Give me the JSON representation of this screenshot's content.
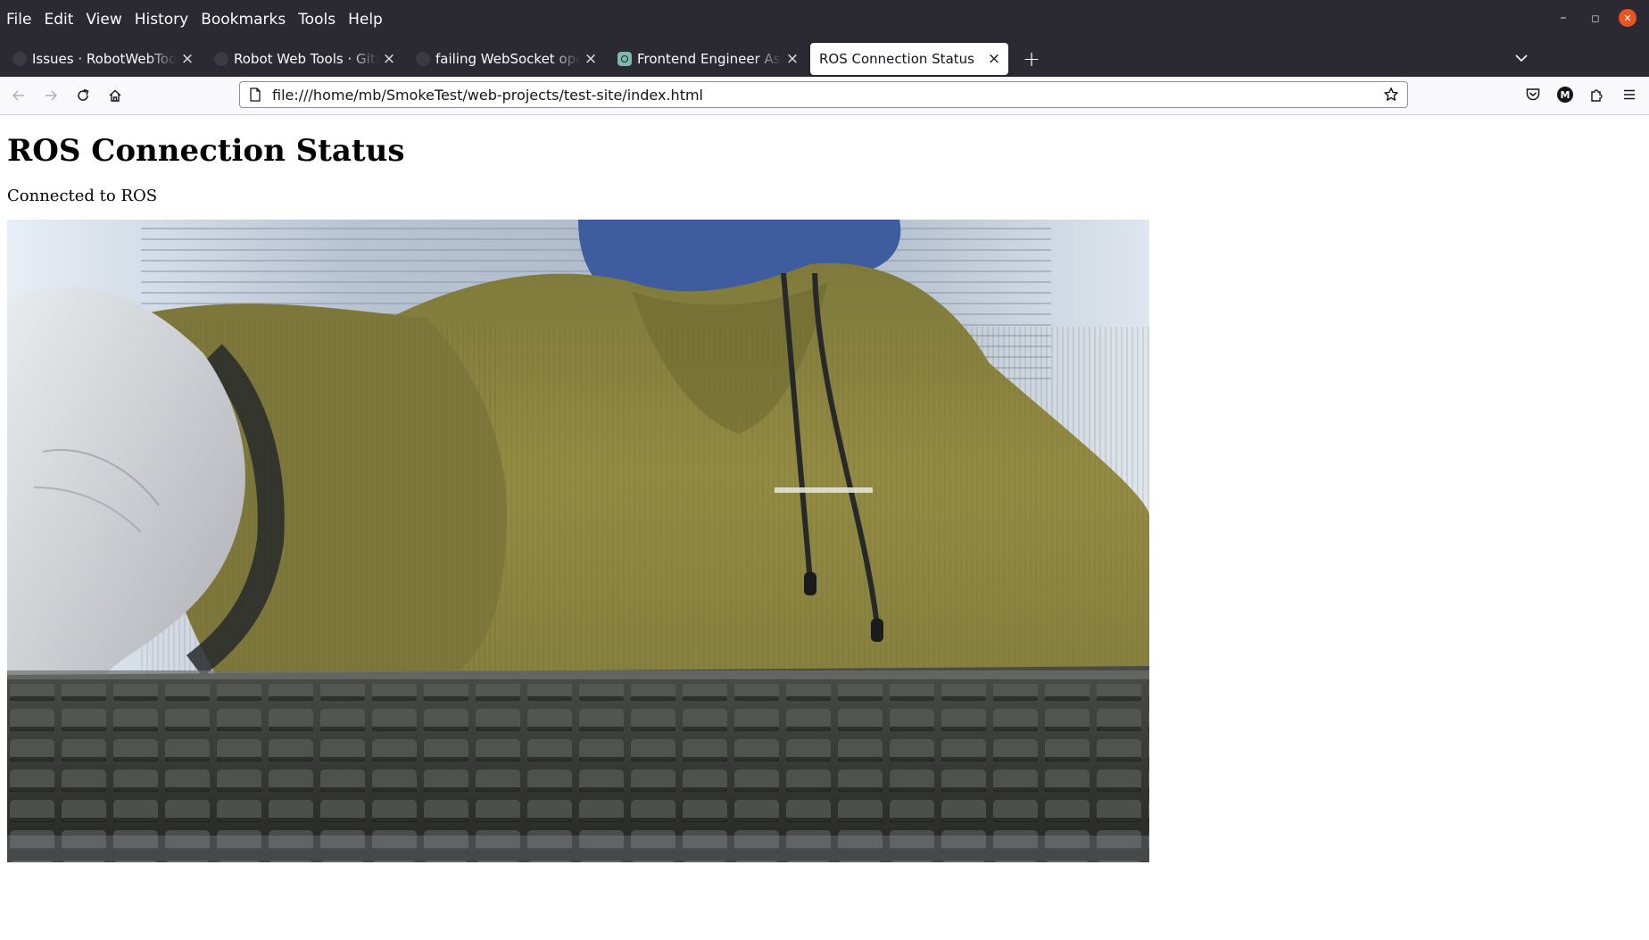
{
  "menu": [
    "File",
    "Edit",
    "View",
    "History",
    "Bookmarks",
    "Tools",
    "Help"
  ],
  "window_controls": {
    "minimize": "–",
    "restore": "◻",
    "close": "✕"
  },
  "tabs": [
    {
      "title": "Issues · RobotWebTools/r",
      "favicon": "github-icon",
      "active": false
    },
    {
      "title": "Robot Web Tools · GitHub",
      "favicon": "github-icon",
      "active": false
    },
    {
      "title": "failing WebSocket openin",
      "favicon": "github-icon",
      "active": false
    },
    {
      "title": "Frontend Engineer Assist",
      "favicon": "chatgpt-icon",
      "active": true
    },
    {
      "title": "ROS Connection Status",
      "favicon": "none",
      "active": true
    }
  ],
  "tab_close_glyph": "×",
  "new_tab_glyph": "+",
  "url": "file:///home/mb/SmokeTest/web-projects/test-site/index.html",
  "account_initial": "M",
  "page": {
    "heading": "ROS Connection Status",
    "status": "Connected to ROS"
  },
  "colors": {
    "chrome_dark": "#2b2a33",
    "toolbar_light": "#f9f9fb",
    "close_button": "#e95420",
    "hoodie_olive": "#8c843f",
    "keyboard_dark": "#2e2f2c"
  }
}
